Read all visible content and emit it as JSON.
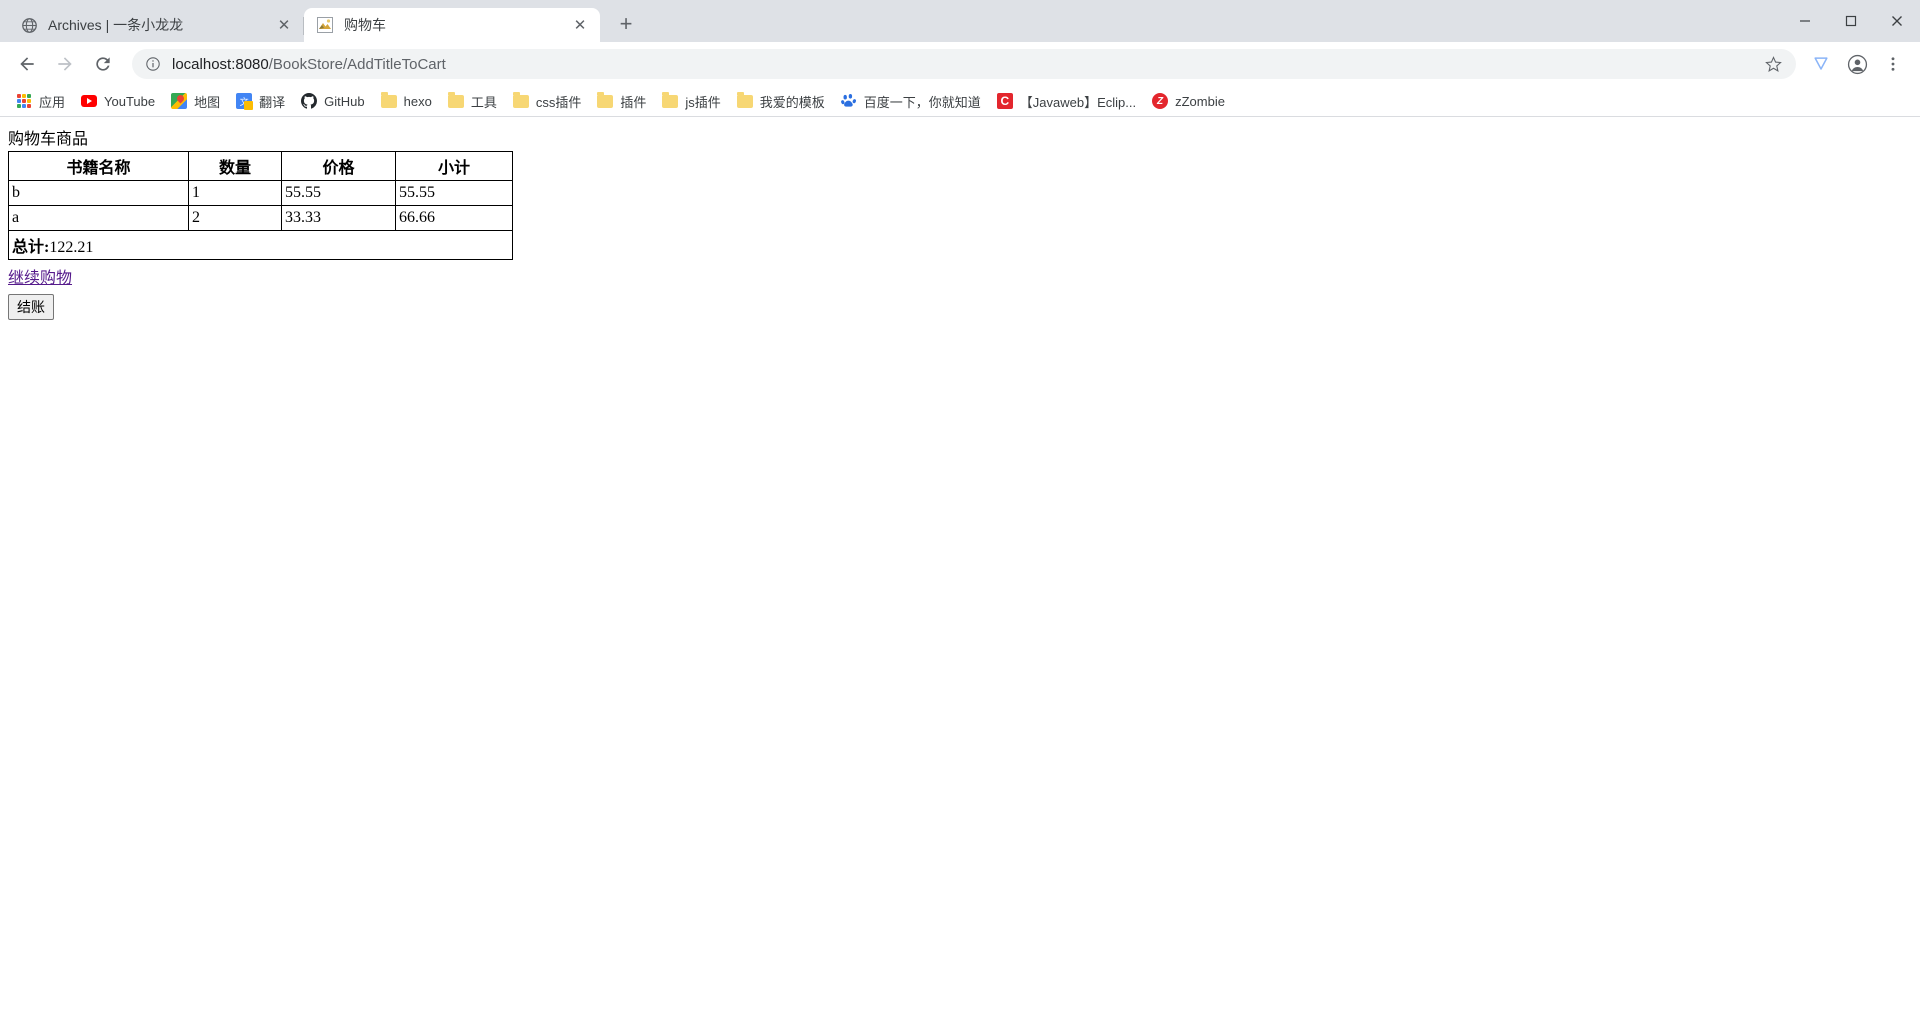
{
  "window": {
    "controls": {
      "minimize_label": "−",
      "maximize_label": "□",
      "close_label": "✕"
    }
  },
  "tabstrip": {
    "tabs": [
      {
        "title": "Archives | 一条小龙龙",
        "favicon": "globe-icon",
        "active": false,
        "close_label": "✕"
      },
      {
        "title": "购物车",
        "favicon": "page-icon",
        "active": true,
        "close_label": "✕"
      }
    ],
    "new_tab_label": "+"
  },
  "toolbar": {
    "back_label": "←",
    "forward_label": "→",
    "reload_label": "⟳",
    "info_label": "ⓘ",
    "url_host": "localhost:8080",
    "url_path": "/BookStore/AddTitleToCart",
    "url_full": "localhost:8080/BookStore/AddTitleToCart",
    "star_label": "☆",
    "extension_label": "V",
    "profile_label": "●",
    "menu_label": "⋮"
  },
  "bookmarks": [
    {
      "label": "应用",
      "icon": "apps-grid-icon"
    },
    {
      "label": "YouTube",
      "icon": "youtube-icon"
    },
    {
      "label": "地图",
      "icon": "google-maps-icon"
    },
    {
      "label": "翻译",
      "icon": "google-translate-icon"
    },
    {
      "label": "GitHub",
      "icon": "github-icon"
    },
    {
      "label": "hexo",
      "icon": "folder-icon"
    },
    {
      "label": "工具",
      "icon": "folder-icon"
    },
    {
      "label": "css插件",
      "icon": "folder-icon"
    },
    {
      "label": "插件",
      "icon": "folder-icon"
    },
    {
      "label": "js插件",
      "icon": "folder-icon"
    },
    {
      "label": "我爱的模板",
      "icon": "folder-icon"
    },
    {
      "label": "百度一下，你就知道",
      "icon": "baidu-icon"
    },
    {
      "label": "【Javaweb】Eclip...",
      "icon": "csdn-icon"
    },
    {
      "label": "zZombie",
      "icon": "zzombie-icon"
    }
  ],
  "page": {
    "heading": "购物车商品",
    "table": {
      "headers": [
        "书籍名称",
        "数量",
        "价格",
        "小计"
      ],
      "rows": [
        {
          "name": "b",
          "qty": "1",
          "price": "55.55",
          "subtotal": "55.55"
        },
        {
          "name": "a",
          "qty": "2",
          "price": "33.33",
          "subtotal": "66.66"
        }
      ],
      "total_label": "总计:",
      "total_value": "122.21"
    },
    "continue_shopping_link": "继续购物",
    "checkout_button": "结账"
  },
  "colors": {
    "tabstrip_bg": "#dee1e6",
    "active_tab_bg": "#ffffff",
    "omnibox_bg": "#f1f3f4",
    "link_visited": "#551a8b",
    "folder_yellow": "#f7d774"
  }
}
